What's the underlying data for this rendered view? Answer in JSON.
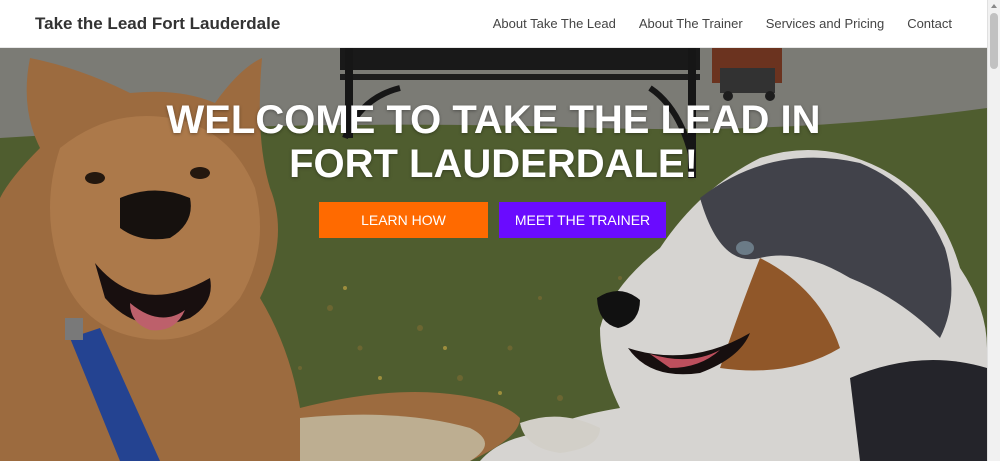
{
  "header": {
    "brand": "Take the Lead Fort Lauderdale",
    "nav": [
      {
        "label": "About Take The Lead"
      },
      {
        "label": "About The Trainer"
      },
      {
        "label": "Services and Pricing"
      },
      {
        "label": "Contact"
      }
    ]
  },
  "hero": {
    "title_line1": "WELCOME TO TAKE THE LEAD IN",
    "title_line2": "FORT LAUDERDALE!",
    "primary_button": "LEARN HOW",
    "secondary_button": "MEET THE TRAINER",
    "primary_color": "#ff6a00",
    "secondary_color": "#6a0bff",
    "image": "two-dogs-on-grass-photo"
  }
}
